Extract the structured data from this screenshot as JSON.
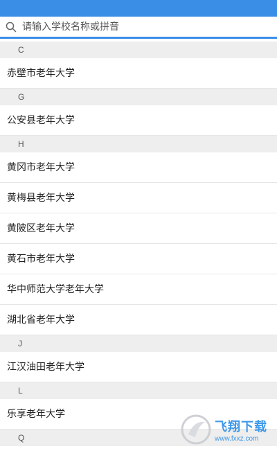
{
  "search": {
    "placeholder": "请输入学校名称或拼音",
    "value": ""
  },
  "sections": [
    {
      "letter": "C",
      "items": [
        "赤壁市老年大学"
      ]
    },
    {
      "letter": "G",
      "items": [
        "公安县老年大学"
      ]
    },
    {
      "letter": "H",
      "items": [
        "黄冈市老年大学",
        "黄梅县老年大学",
        "黄陂区老年大学",
        "黄石市老年大学",
        "华中师范大学老年大学",
        "湖北省老年大学"
      ]
    },
    {
      "letter": "J",
      "items": [
        "江汉油田老年大学"
      ]
    },
    {
      "letter": "L",
      "items": [
        "乐享老年大学"
      ]
    },
    {
      "letter": "Q",
      "items": []
    }
  ],
  "watermark": {
    "title": "飞翔下载",
    "url": "www.fxxz.com"
  },
  "colors": {
    "accent": "#3a8ee6",
    "section_bg": "#eeeeee"
  }
}
